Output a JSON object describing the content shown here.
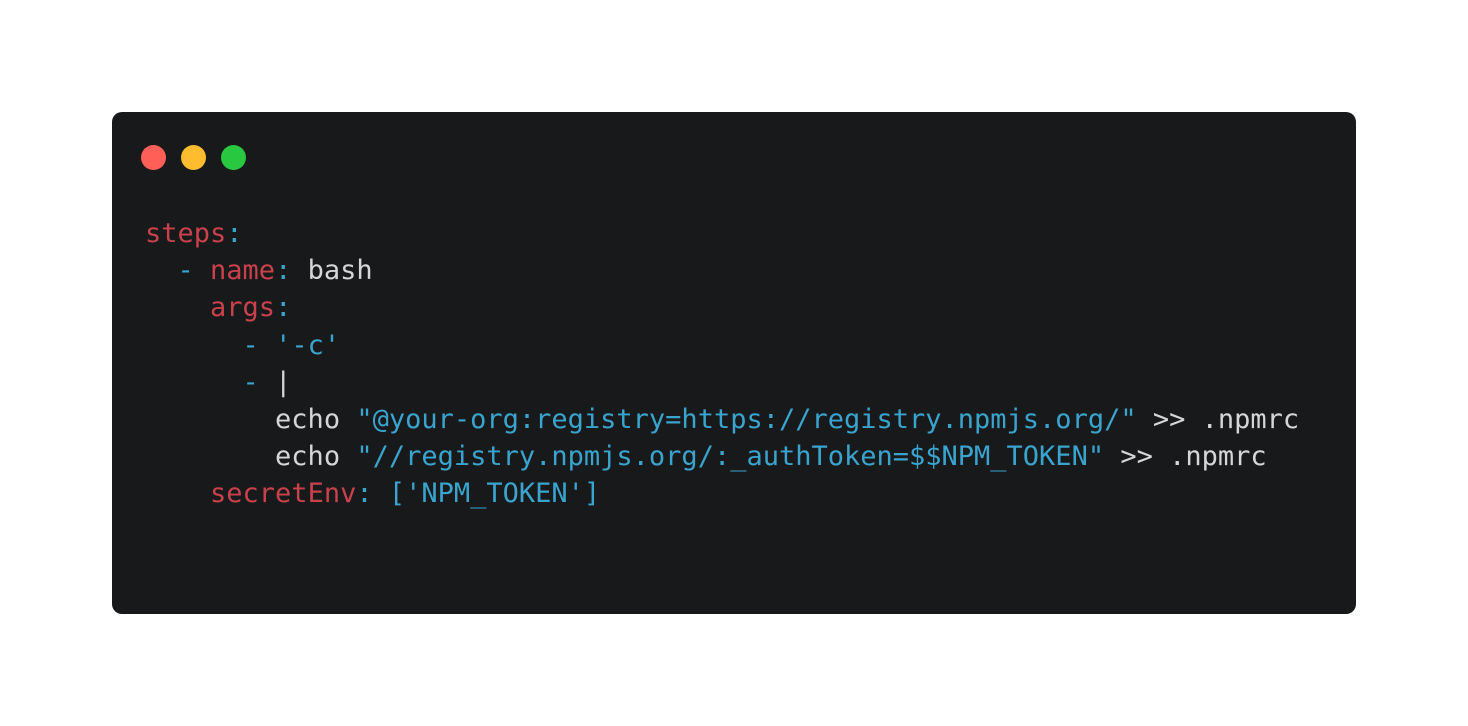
{
  "colors": {
    "window_background": "#18191b",
    "key": "#c9414b",
    "punctuation": "#39a5cf",
    "string": "#39a5cf",
    "plain": "#d6d6d6",
    "dot_red": "#ff5f57",
    "dot_yellow": "#febc2e",
    "dot_green": "#28c840"
  },
  "window_controls": [
    "close",
    "minimize",
    "maximize"
  ],
  "code": {
    "language": "yaml",
    "lines": [
      {
        "indent": "",
        "tokens": [
          {
            "t": "key",
            "v": "steps"
          },
          {
            "t": "punc",
            "v": ":"
          }
        ]
      },
      {
        "indent": "  ",
        "tokens": [
          {
            "t": "punc",
            "v": "- "
          },
          {
            "t": "key",
            "v": "name"
          },
          {
            "t": "punc",
            "v": ": "
          },
          {
            "t": "plain",
            "v": "bash"
          }
        ]
      },
      {
        "indent": "    ",
        "tokens": [
          {
            "t": "key",
            "v": "args"
          },
          {
            "t": "punc",
            "v": ":"
          }
        ]
      },
      {
        "indent": "      ",
        "tokens": [
          {
            "t": "punc",
            "v": "- "
          },
          {
            "t": "str",
            "v": "'-c'"
          }
        ]
      },
      {
        "indent": "      ",
        "tokens": [
          {
            "t": "punc",
            "v": "- "
          },
          {
            "t": "plain",
            "v": "|"
          }
        ]
      },
      {
        "indent": "        ",
        "tokens": [
          {
            "t": "plain",
            "v": "echo "
          },
          {
            "t": "str",
            "v": "\"@your-org:registry=https://registry.npmjs.org/\""
          },
          {
            "t": "plain",
            "v": " >> .npmrc"
          }
        ]
      },
      {
        "indent": "        ",
        "tokens": [
          {
            "t": "plain",
            "v": "echo "
          },
          {
            "t": "str",
            "v": "\"//registry.npmjs.org/:_authToken=$$NPM_TOKEN\""
          },
          {
            "t": "plain",
            "v": " >> .npmrc"
          }
        ]
      },
      {
        "indent": "    ",
        "tokens": [
          {
            "t": "key",
            "v": "secretEnv"
          },
          {
            "t": "punc",
            "v": ": "
          },
          {
            "t": "str",
            "v": "['NPM_TOKEN']"
          }
        ]
      }
    ]
  }
}
